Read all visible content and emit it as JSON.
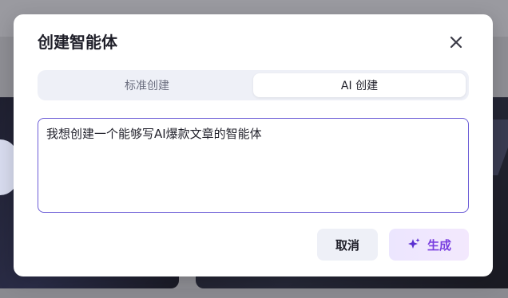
{
  "dialog": {
    "title": "创建智能体",
    "close_icon": "close-icon"
  },
  "tabs": [
    {
      "label": "标准创建",
      "active": false
    },
    {
      "label": "AI 创建",
      "active": true
    }
  ],
  "prompt": {
    "value": "我想创建一个能够写AI爆款文章的智能体"
  },
  "actions": {
    "cancel_label": "取消",
    "generate_label": "生成",
    "generate_icon": "sparkle-icon"
  },
  "colors": {
    "accent": "#7a3fe0",
    "input_border": "#6b5cd6",
    "tab_bg": "#eef0f7"
  }
}
